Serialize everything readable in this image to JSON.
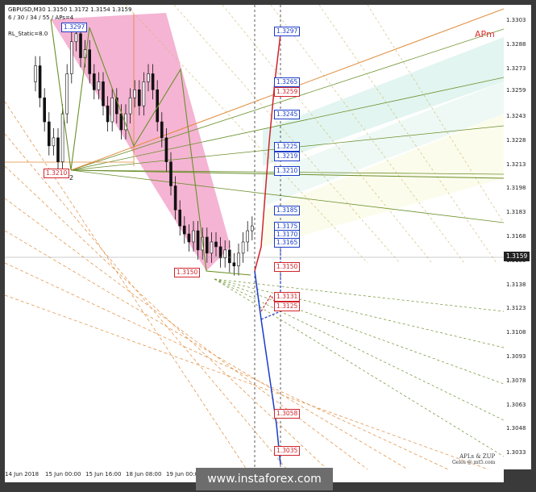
{
  "header": {
    "symbol_line": "GBPUSD,M30  1.3150 1.3172 1.3154 1.3159",
    "params_line": "6 / 30 / 34 / 55 / APs=4",
    "indicator_line": "RL_Static=8.0"
  },
  "apm_label": "APm",
  "credits": {
    "line1": "APLs & ZUP",
    "line2": "Gelos @ mt5.com"
  },
  "banner": "www.instaforex.com",
  "current_price": "1.3159",
  "colors": {
    "blue": "#1a3cc9",
    "red": "#d1242b",
    "pink": "#f29bc4",
    "teal": "#dff4ee",
    "green": "#6a8f2a",
    "orange": "#e08a3a"
  },
  "chart_data": {
    "type": "candlestick",
    "symbol": "GBPUSD",
    "timeframe": "M30",
    "ylim": [
      1.3026,
      1.3308
    ],
    "y_ticks": [
      "1.3303",
      "1.3288",
      "1.3273",
      "1.3259",
      "1.3243",
      "1.3228",
      "1.3213",
      "1.3198",
      "1.3183",
      "1.3168",
      "1.3153",
      "1.3138",
      "1.3123",
      "1.3108",
      "1.3093",
      "1.3078",
      "1.3063",
      "1.3048",
      "1.3033"
    ],
    "x_ticks": [
      "14 Jun 2018",
      "15 Jun 00:00",
      "15 Jun 16:00",
      "18 Jun 08:00",
      "19 Jun 00:00"
    ],
    "price_labels": [
      {
        "text": "1.3297",
        "color": "blue",
        "side": "left"
      },
      {
        "text": "1.3210",
        "color": "red",
        "side": "left"
      },
      {
        "text": "1.3150",
        "color": "red",
        "side": "left"
      },
      {
        "text": "1.3297",
        "color": "blue",
        "side": "right"
      },
      {
        "text": "1.3265",
        "color": "blue",
        "side": "right"
      },
      {
        "text": "1.3259",
        "color": "red",
        "side": "right"
      },
      {
        "text": "1.3245",
        "color": "blue",
        "side": "right"
      },
      {
        "text": "1.3225",
        "color": "blue",
        "side": "right"
      },
      {
        "text": "1.3219",
        "color": "blue",
        "side": "right"
      },
      {
        "text": "1.3210",
        "color": "blue",
        "side": "right"
      },
      {
        "text": "1.3185",
        "color": "blue",
        "side": "right"
      },
      {
        "text": "1.3175",
        "color": "blue",
        "side": "right"
      },
      {
        "text": "1.3170",
        "color": "blue",
        "side": "right"
      },
      {
        "text": "1.3165",
        "color": "blue",
        "side": "right"
      },
      {
        "text": "1.3150",
        "color": "red",
        "side": "right"
      },
      {
        "text": "1.3131",
        "color": "red",
        "side": "right"
      },
      {
        "text": "1.3125",
        "color": "red",
        "side": "right"
      },
      {
        "text": "1.3058",
        "color": "red",
        "side": "right"
      },
      {
        "text": "1.3035",
        "color": "red",
        "side": "right"
      }
    ],
    "pivot_label": "2"
  }
}
